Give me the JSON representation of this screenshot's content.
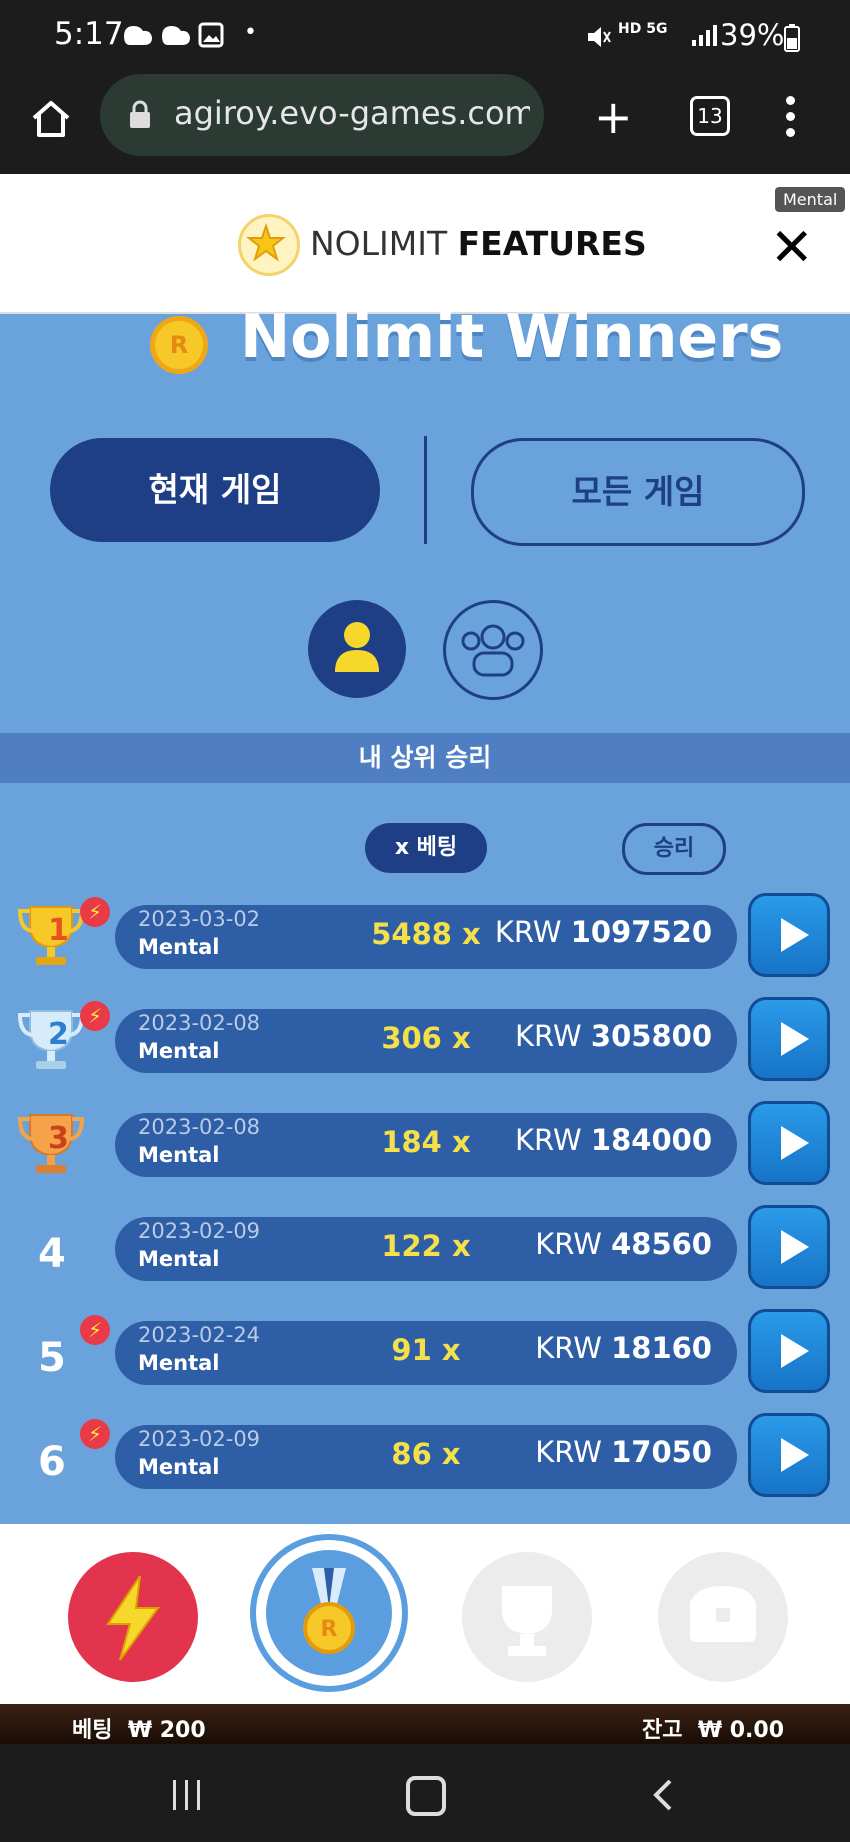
{
  "status_bar": {
    "time": "5:17",
    "battery": "39%",
    "signal_text": "HD 5G"
  },
  "browser": {
    "url": "agiroy.evo-games.com/f",
    "tab_count": "13"
  },
  "header": {
    "brand_light": "NOLIMIT",
    "brand_bold": "FEATURES",
    "game_badge": "Mental"
  },
  "page": {
    "title": "Nolimit Winners",
    "medal_text": "R"
  },
  "game_toggle": {
    "current": "현재 게임",
    "all": "모든 게임"
  },
  "section": {
    "title": "내 상위 승리",
    "sort_bet": "x 베팅",
    "sort_win": "승리"
  },
  "rows": [
    {
      "rank": "1",
      "date": "2023-03-02",
      "game": "Mental",
      "multiplier": "5488 x",
      "currency": "KRW",
      "amount": "1097520"
    },
    {
      "rank": "2",
      "date": "2023-02-08",
      "game": "Mental",
      "multiplier": "306 x",
      "currency": "KRW",
      "amount": "305800"
    },
    {
      "rank": "3",
      "date": "2023-02-08",
      "game": "Mental",
      "multiplier": "184 x",
      "currency": "KRW",
      "amount": "184000"
    },
    {
      "rank": "4",
      "date": "2023-02-09",
      "game": "Mental",
      "multiplier": "122 x",
      "currency": "KRW",
      "amount": "48560"
    },
    {
      "rank": "5",
      "date": "2023-02-24",
      "game": "Mental",
      "multiplier": "91 x",
      "currency": "KRW",
      "amount": "18160"
    },
    {
      "rank": "6",
      "date": "2023-02-09",
      "game": "Mental",
      "multiplier": "86 x",
      "currency": "KRW",
      "amount": "17050"
    }
  ],
  "balance_bar": {
    "bet_label": "베팅",
    "bet_value": "₩ 200",
    "balance_label": "잔고",
    "balance_value": "₩ 0.00"
  },
  "colors": {
    "background": "#6aa3dc",
    "accent_dark": "#1e3f86",
    "multiplier": "#f5e04a",
    "play_button": "#1674c8"
  }
}
